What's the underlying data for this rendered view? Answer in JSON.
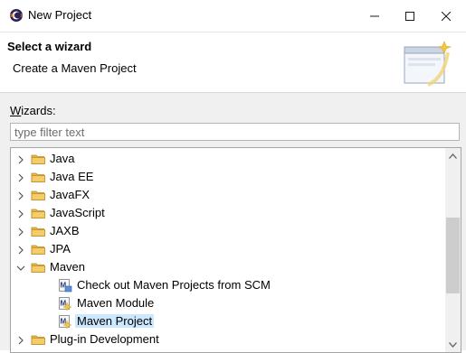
{
  "window": {
    "title": "New Project",
    "app_icon": "eclipse-icon",
    "controls": [
      "minimize-icon",
      "maximize-icon",
      "close-icon"
    ]
  },
  "banner": {
    "title": "Select a wizard",
    "description": "Create a Maven Project",
    "graphic": "new-wizard-graphic"
  },
  "wizards": {
    "label": "Wizards:",
    "mnemonic": "W",
    "label_rest": "izards:",
    "filter_placeholder": "type filter text"
  },
  "tree": {
    "items": [
      {
        "label": "Java",
        "type": "folder",
        "expanded": false
      },
      {
        "label": "Java EE",
        "type": "folder",
        "expanded": false
      },
      {
        "label": "JavaFX",
        "type": "folder",
        "expanded": false
      },
      {
        "label": "JavaScript",
        "type": "folder",
        "expanded": false
      },
      {
        "label": "JAXB",
        "type": "folder",
        "expanded": false
      },
      {
        "label": "JPA",
        "type": "folder",
        "expanded": false
      },
      {
        "label": "Maven",
        "type": "folder",
        "expanded": true
      },
      {
        "label": "Check out Maven Projects from SCM",
        "type": "maven-scm",
        "child": true
      },
      {
        "label": "Maven Module",
        "type": "maven",
        "child": true
      },
      {
        "label": "Maven Project",
        "type": "maven",
        "child": true,
        "selected": true
      },
      {
        "label": "Plug-in Development",
        "type": "folder",
        "expanded": false
      }
    ]
  },
  "colors": {
    "selection": "#cce8ff",
    "folder": "#e8b84a",
    "scroll_thumb": "#cdcdcd"
  }
}
